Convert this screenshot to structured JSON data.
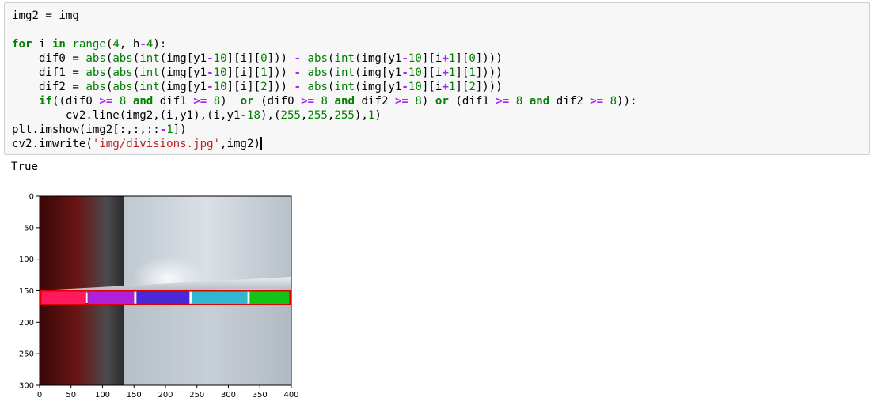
{
  "cell": {
    "lines": [
      [
        {
          "t": "img2 = img",
          "c": ""
        }
      ],
      [
        {
          "t": "",
          "c": ""
        }
      ],
      [
        {
          "t": "for",
          "c": "kw"
        },
        {
          "t": " i ",
          "c": ""
        },
        {
          "t": "in",
          "c": "kw"
        },
        {
          "t": " ",
          "c": ""
        },
        {
          "t": "range",
          "c": "bi"
        },
        {
          "t": "(",
          "c": ""
        },
        {
          "t": "4",
          "c": "nm"
        },
        {
          "t": ", h",
          "c": ""
        },
        {
          "t": "-",
          "c": "op"
        },
        {
          "t": "4",
          "c": "nm"
        },
        {
          "t": "):",
          "c": ""
        }
      ],
      [
        {
          "t": "    dif0 = ",
          "c": ""
        },
        {
          "t": "abs",
          "c": "bi"
        },
        {
          "t": "(",
          "c": ""
        },
        {
          "t": "abs",
          "c": "bi"
        },
        {
          "t": "(",
          "c": ""
        },
        {
          "t": "int",
          "c": "bi"
        },
        {
          "t": "(img[y1",
          "c": ""
        },
        {
          "t": "-",
          "c": "op"
        },
        {
          "t": "10",
          "c": "nm"
        },
        {
          "t": "][i][",
          "c": ""
        },
        {
          "t": "0",
          "c": "nm"
        },
        {
          "t": "])) ",
          "c": ""
        },
        {
          "t": "-",
          "c": "op"
        },
        {
          "t": " ",
          "c": ""
        },
        {
          "t": "abs",
          "c": "bi"
        },
        {
          "t": "(",
          "c": ""
        },
        {
          "t": "int",
          "c": "bi"
        },
        {
          "t": "(img[y1",
          "c": ""
        },
        {
          "t": "-",
          "c": "op"
        },
        {
          "t": "10",
          "c": "nm"
        },
        {
          "t": "][i",
          "c": ""
        },
        {
          "t": "+",
          "c": "op"
        },
        {
          "t": "1",
          "c": "nm"
        },
        {
          "t": "][",
          "c": ""
        },
        {
          "t": "0",
          "c": "nm"
        },
        {
          "t": "])))",
          "c": ""
        }
      ],
      [
        {
          "t": "    dif1 = ",
          "c": ""
        },
        {
          "t": "abs",
          "c": "bi"
        },
        {
          "t": "(",
          "c": ""
        },
        {
          "t": "abs",
          "c": "bi"
        },
        {
          "t": "(",
          "c": ""
        },
        {
          "t": "int",
          "c": "bi"
        },
        {
          "t": "(img[y1",
          "c": ""
        },
        {
          "t": "-",
          "c": "op"
        },
        {
          "t": "10",
          "c": "nm"
        },
        {
          "t": "][i][",
          "c": ""
        },
        {
          "t": "1",
          "c": "nm"
        },
        {
          "t": "])) ",
          "c": ""
        },
        {
          "t": "-",
          "c": "op"
        },
        {
          "t": " ",
          "c": ""
        },
        {
          "t": "abs",
          "c": "bi"
        },
        {
          "t": "(",
          "c": ""
        },
        {
          "t": "int",
          "c": "bi"
        },
        {
          "t": "(img[y1",
          "c": ""
        },
        {
          "t": "-",
          "c": "op"
        },
        {
          "t": "10",
          "c": "nm"
        },
        {
          "t": "][i",
          "c": ""
        },
        {
          "t": "+",
          "c": "op"
        },
        {
          "t": "1",
          "c": "nm"
        },
        {
          "t": "][",
          "c": ""
        },
        {
          "t": "1",
          "c": "nm"
        },
        {
          "t": "])))",
          "c": ""
        }
      ],
      [
        {
          "t": "    dif2 = ",
          "c": ""
        },
        {
          "t": "abs",
          "c": "bi"
        },
        {
          "t": "(",
          "c": ""
        },
        {
          "t": "abs",
          "c": "bi"
        },
        {
          "t": "(",
          "c": ""
        },
        {
          "t": "int",
          "c": "bi"
        },
        {
          "t": "(img[y1",
          "c": ""
        },
        {
          "t": "-",
          "c": "op"
        },
        {
          "t": "10",
          "c": "nm"
        },
        {
          "t": "][i][",
          "c": ""
        },
        {
          "t": "2",
          "c": "nm"
        },
        {
          "t": "])) ",
          "c": ""
        },
        {
          "t": "-",
          "c": "op"
        },
        {
          "t": " ",
          "c": ""
        },
        {
          "t": "abs",
          "c": "bi"
        },
        {
          "t": "(",
          "c": ""
        },
        {
          "t": "int",
          "c": "bi"
        },
        {
          "t": "(img[y1",
          "c": ""
        },
        {
          "t": "-",
          "c": "op"
        },
        {
          "t": "10",
          "c": "nm"
        },
        {
          "t": "][i",
          "c": ""
        },
        {
          "t": "+",
          "c": "op"
        },
        {
          "t": "1",
          "c": "nm"
        },
        {
          "t": "][",
          "c": ""
        },
        {
          "t": "2",
          "c": "nm"
        },
        {
          "t": "])))",
          "c": ""
        }
      ],
      [
        {
          "t": "    ",
          "c": ""
        },
        {
          "t": "if",
          "c": "kw"
        },
        {
          "t": "((dif0 ",
          "c": ""
        },
        {
          "t": ">=",
          "c": "op"
        },
        {
          "t": " ",
          "c": ""
        },
        {
          "t": "8",
          "c": "nm"
        },
        {
          "t": " ",
          "c": ""
        },
        {
          "t": "and",
          "c": "kw"
        },
        {
          "t": " dif1 ",
          "c": ""
        },
        {
          "t": ">=",
          "c": "op"
        },
        {
          "t": " ",
          "c": ""
        },
        {
          "t": "8",
          "c": "nm"
        },
        {
          "t": ")  ",
          "c": ""
        },
        {
          "t": "or",
          "c": "kw"
        },
        {
          "t": " (dif0 ",
          "c": ""
        },
        {
          "t": ">=",
          "c": "op"
        },
        {
          "t": " ",
          "c": ""
        },
        {
          "t": "8",
          "c": "nm"
        },
        {
          "t": " ",
          "c": ""
        },
        {
          "t": "and",
          "c": "kw"
        },
        {
          "t": " dif2 ",
          "c": ""
        },
        {
          "t": ">=",
          "c": "op"
        },
        {
          "t": " ",
          "c": ""
        },
        {
          "t": "8",
          "c": "nm"
        },
        {
          "t": ") ",
          "c": ""
        },
        {
          "t": "or",
          "c": "kw"
        },
        {
          "t": " (dif1 ",
          "c": ""
        },
        {
          "t": ">=",
          "c": "op"
        },
        {
          "t": " ",
          "c": ""
        },
        {
          "t": "8",
          "c": "nm"
        },
        {
          "t": " ",
          "c": ""
        },
        {
          "t": "and",
          "c": "kw"
        },
        {
          "t": " dif2 ",
          "c": ""
        },
        {
          "t": ">=",
          "c": "op"
        },
        {
          "t": " ",
          "c": ""
        },
        {
          "t": "8",
          "c": "nm"
        },
        {
          "t": ")):",
          "c": ""
        }
      ],
      [
        {
          "t": "        cv2.line(img2,(i,y1),(i,y1",
          "c": ""
        },
        {
          "t": "-",
          "c": "op"
        },
        {
          "t": "18",
          "c": "nm"
        },
        {
          "t": "),(",
          "c": ""
        },
        {
          "t": "255",
          "c": "nm"
        },
        {
          "t": ",",
          "c": ""
        },
        {
          "t": "255",
          "c": "nm"
        },
        {
          "t": ",",
          "c": ""
        },
        {
          "t": "255",
          "c": "nm"
        },
        {
          "t": "),",
          "c": ""
        },
        {
          "t": "1",
          "c": "nm"
        },
        {
          "t": ")",
          "c": ""
        }
      ],
      [
        {
          "t": "plt.imshow(img2[:,:,::",
          "c": ""
        },
        {
          "t": "-",
          "c": "op"
        },
        {
          "t": "1",
          "c": "nm"
        },
        {
          "t": "])",
          "c": ""
        }
      ],
      [
        {
          "t": "cv2.imwrite(",
          "c": ""
        },
        {
          "t": "'img/divisions.jpg'",
          "c": "st"
        },
        {
          "t": ",img2)",
          "c": ""
        }
      ]
    ]
  },
  "output": {
    "result": "True"
  },
  "plot": {
    "y_ticks": [
      "0",
      "50",
      "100",
      "150",
      "200",
      "250",
      "300"
    ],
    "x_ticks": [
      "0",
      "50",
      "100",
      "150",
      "200",
      "250",
      "300",
      "350",
      "400"
    ],
    "colors": {
      "background_left": "#5a1010",
      "background_right": "#cdd5dc",
      "strip_border": "#e00000",
      "divider": "#ffffff",
      "segments": [
        "#ff1a5e",
        "#b020d8",
        "#4a28d6",
        "#2eb8d0",
        "#12c414"
      ]
    }
  }
}
